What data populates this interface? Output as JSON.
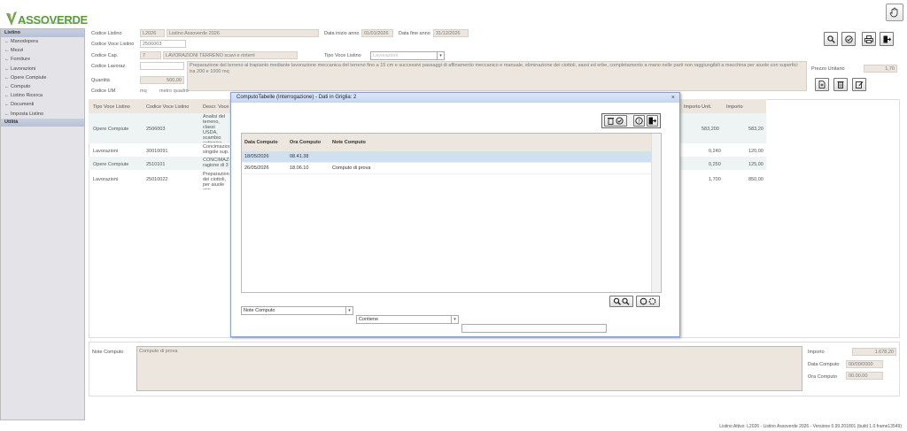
{
  "app": {
    "logo_text": "ASSOVERDE",
    "logo_sub": "ASSOCIAZIONE ITALIANA COSTRUTTORI DEL VERDE",
    "status_bar": "Listino Attivo: L2026 - Listino Assoverde 2026 - Versione 0.99.201801 (build 1.0.frame13549)"
  },
  "icons": {
    "top_right": "hand-pointer-icon",
    "toolbar": [
      "search-icon",
      "check-circle-icon",
      "print-icon",
      "exit-icon"
    ],
    "price_tools": [
      "new-document-icon",
      "trash-icon",
      "edit-icon"
    ]
  },
  "sidebar": {
    "header": "Listino",
    "items": [
      {
        "label": "← Manodopera"
      },
      {
        "label": "← Mezzi"
      },
      {
        "label": "← Forniture"
      },
      {
        "label": "← Lavorazioni"
      },
      {
        "label": "← Opere Compiute"
      },
      {
        "label": "← Computo"
      },
      {
        "label": "← Listino Ricerca"
      },
      {
        "label": "← Documenti"
      },
      {
        "label": "← Imposta Listino"
      }
    ],
    "footer": "Utilità"
  },
  "form": {
    "codice_listino_label": "Codice Listino",
    "codice_listino": "L2026",
    "listino_name": "Listino Assoverde 2026",
    "data_inizio_label": "Data inizio anno",
    "data_inizio": "01/01/2026",
    "data_fine_label": "Data fine anno",
    "data_fine": "31/12/2026",
    "codice_voce_label": "Codice Voce Listino",
    "codice_voce": "2506003",
    "codice_cap_label": "Codice Cap.",
    "codice_cap": "7",
    "cap_desc": "LAVORAZIONI TERRENO scavi e rinterri",
    "tipo_voce_label": "Tipo Voce Listino",
    "tipo_voce": "Lavorazioni",
    "codice_lavoraz_label": "Codice Lavoraz.",
    "description": "Preparazione del terreno al trapianto mediante lavorazione meccanica del terreno fino a 15 cm e successivi passaggi di affinamento meccanico e manuale, eliminazione dei ciottoli, sassi ed erbe, completamento a mano nelle parti non raggiungibili a macchina per aiuole con superfici tra 200 e 1000 mq",
    "prezzo_label": "Prezzo Unitario",
    "prezzo": "1,70",
    "quantita_label": "Quantità",
    "quantita": "500,00",
    "codice_um_label": "Codice UM",
    "codice_um": "mq",
    "um_desc": "metro quadro"
  },
  "grid": {
    "headers": [
      "Tipo Voce Listino",
      "Codice Voce Listino",
      "Descr. Voce",
      "Importo Unit.",
      "Importo"
    ],
    "rows": [
      {
        "tipo": "Opere Compiute",
        "codice": "2506003",
        "descr": "Analisi del terreno, classi USDA, scambio cationico, scambiabili, C/N, Ca/Mg",
        "imp_unit": "583,200",
        "importo": "583,20"
      },
      {
        "tipo": "Lavorazioni",
        "codice": "30010091",
        "descr": "Concimazione singole sup.",
        "imp_unit": "0,240",
        "importo": "120,00"
      },
      {
        "tipo": "Opere Compiute",
        "codice": "2510101",
        "descr": "CONCIMAZIONE ragione di 3",
        "imp_unit": "0,250",
        "importo": "125,00"
      },
      {
        "tipo": "Lavorazioni",
        "codice": "25010022",
        "descr": "Preparazione dei ciottoli, per aiuole con",
        "imp_unit": "1,700",
        "importo": "850,00"
      }
    ]
  },
  "bottom": {
    "note_label": "Note Computo",
    "note_value": "Computo di prova",
    "importo_label": "Importo",
    "importo": "1.678,20",
    "data_computo_label": "Data Computo",
    "data_computo": "00/00/0000",
    "ora_computo_label": "Ora Computo",
    "ora_computo": "00.00.00"
  },
  "modal": {
    "title": "ComputoTabelle (Interrogazione) - Dati in Griglia: 2",
    "close": "×",
    "headers": [
      "Data Computo",
      "Ora Computo",
      "Note Computo"
    ],
    "rows": [
      {
        "data": "18/05/2026",
        "ora": "08.41.38",
        "note": ""
      },
      {
        "data": "26/05/2026",
        "ora": "18.06.10",
        "note": "Computo di prova"
      }
    ],
    "filter_field": "Note Computo",
    "filter_op": "Contiene",
    "filter_value": ""
  }
}
